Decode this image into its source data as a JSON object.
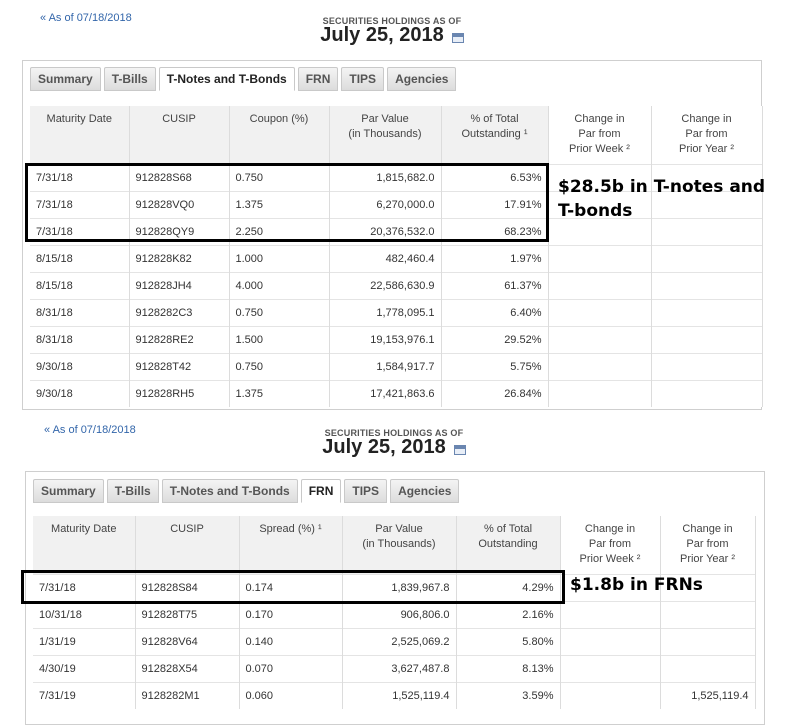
{
  "top": {
    "back_link": "« As of 07/18/2018",
    "header_label": "SECURITIES HOLDINGS AS OF",
    "header_date": "July 25, 2018",
    "tabs": [
      {
        "label": "Summary",
        "active": false
      },
      {
        "label": "T-Bills",
        "active": false
      },
      {
        "label": "T-Notes and T-Bonds",
        "active": true
      },
      {
        "label": "FRN",
        "active": false
      },
      {
        "label": "TIPS",
        "active": false
      },
      {
        "label": "Agencies",
        "active": false
      }
    ],
    "columns": [
      "Maturity Date",
      "CUSIP",
      "Coupon (%)",
      "Par Value\n(in Thousands)",
      "% of Total\nOutstanding ¹",
      "Change in\nPar from\nPrior Week ²",
      "Change in\nPar from\nPrior Year ²"
    ],
    "rows": [
      [
        "7/31/18",
        "912828S68",
        "0.750",
        "1,815,682.0",
        "6.53%",
        "",
        ""
      ],
      [
        "7/31/18",
        "912828VQ0",
        "1.375",
        "6,270,000.0",
        "17.91%",
        "",
        ""
      ],
      [
        "7/31/18",
        "912828QY9",
        "2.250",
        "20,376,532.0",
        "68.23%",
        "",
        ""
      ],
      [
        "8/15/18",
        "912828K82",
        "1.000",
        "482,460.4",
        "1.97%",
        "",
        ""
      ],
      [
        "8/15/18",
        "912828JH4",
        "4.000",
        "22,586,630.9",
        "61.37%",
        "",
        ""
      ],
      [
        "8/31/18",
        "9128282C3",
        "0.750",
        "1,778,095.1",
        "6.40%",
        "",
        ""
      ],
      [
        "8/31/18",
        "912828RE2",
        "1.500",
        "19,153,976.1",
        "29.52%",
        "",
        ""
      ],
      [
        "9/30/18",
        "912828T42",
        "0.750",
        "1,584,917.7",
        "5.75%",
        "",
        ""
      ],
      [
        "9/30/18",
        "912828RH5",
        "1.375",
        "17,421,863.6",
        "26.84%",
        "",
        ""
      ]
    ],
    "annotation": "$28.5b in T-notes and T-bonds"
  },
  "bottom": {
    "back_link": "« As of 07/18/2018",
    "header_label": "SECURITIES HOLDINGS AS OF",
    "header_date": "July 25, 2018",
    "tabs": [
      {
        "label": "Summary",
        "active": false
      },
      {
        "label": "T-Bills",
        "active": false
      },
      {
        "label": "T-Notes and T-Bonds",
        "active": false
      },
      {
        "label": "FRN",
        "active": true
      },
      {
        "label": "TIPS",
        "active": false
      },
      {
        "label": "Agencies",
        "active": false
      }
    ],
    "columns": [
      "Maturity Date",
      "CUSIP",
      "Spread (%) ¹",
      "Par Value\n(in Thousands)",
      "% of Total\nOutstanding",
      "Change in\nPar from\nPrior Week ²",
      "Change in\nPar from\nPrior Year ²"
    ],
    "rows": [
      [
        "7/31/18",
        "912828S84",
        "0.174",
        "1,839,967.8",
        "4.29%",
        "",
        ""
      ],
      [
        "10/31/18",
        "912828T75",
        "0.170",
        "906,806.0",
        "2.16%",
        "",
        ""
      ],
      [
        "1/31/19",
        "912828V64",
        "0.140",
        "2,525,069.2",
        "5.80%",
        "",
        ""
      ],
      [
        "4/30/19",
        "912828X54",
        "0.070",
        "3,627,487.8",
        "8.13%",
        "",
        ""
      ],
      [
        "7/31/19",
        "9128282M1",
        "0.060",
        "1,525,119.4",
        "3.59%",
        "",
        "1,525,119.4"
      ]
    ],
    "annotation": "$1.8b in FRNs"
  },
  "icons": {
    "calendar": "calendar-icon"
  }
}
